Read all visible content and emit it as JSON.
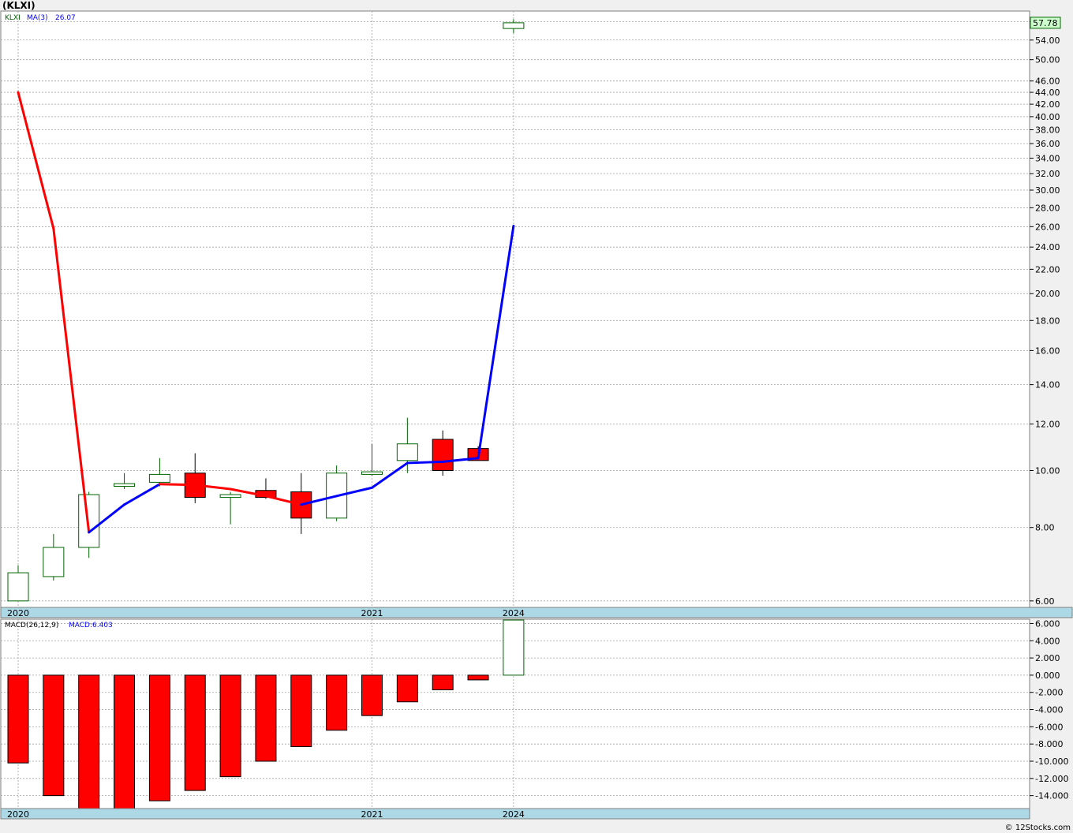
{
  "title": "(KLXI)",
  "legend": {
    "symbol": "KLXI",
    "ma_label": "MA(3)",
    "ma_value": "26.07",
    "macd_label": "MACD(26,12,9)",
    "macd_value_label": "MACD:6.403"
  },
  "last_price_label": "57.78",
  "footer": "© 12Stocks.com",
  "colors": {
    "up": "#006400",
    "down": "#ff0000",
    "ma_up": "#0000ff",
    "ma_down": "#ff0000",
    "date_band": "#add8e6",
    "grid": "#a0a0a0",
    "price_box": "#ccffcc"
  },
  "chart_data": [
    {
      "type": "candlestick",
      "scale": "log",
      "ylim": [
        5.85,
        60.5
      ],
      "y_ticks": [
        6,
        8,
        10,
        12,
        14,
        16,
        18,
        20,
        22,
        24,
        26,
        28,
        30,
        32,
        34,
        36,
        38,
        40,
        42,
        44,
        46,
        50,
        54,
        58
      ],
      "y_tick_labels": [
        "6.00",
        "8.00",
        "10.00",
        "12.00",
        "14.00",
        "16.00",
        "18.00",
        "20.00",
        "22.00",
        "24.00",
        "26.00",
        "28.00",
        "30.00",
        "32.00",
        "34.00",
        "36.00",
        "38.00",
        "40.00",
        "42.00",
        "44.00",
        "46.00",
        "50.00",
        "54.00",
        "58.00"
      ],
      "x_labels": [
        {
          "index": 0,
          "text": "2020"
        },
        {
          "index": 10,
          "text": "2021"
        },
        {
          "index": 14,
          "text": "2024"
        }
      ],
      "candles": [
        {
          "o": 6.0,
          "h": 6.9,
          "l": 6.0,
          "c": 6.7
        },
        {
          "o": 6.6,
          "h": 7.8,
          "l": 6.5,
          "c": 7.4
        },
        {
          "o": 7.4,
          "h": 9.2,
          "l": 7.1,
          "c": 9.1
        },
        {
          "o": 9.4,
          "h": 9.9,
          "l": 9.3,
          "c": 9.5
        },
        {
          "o": 9.55,
          "h": 10.5,
          "l": 9.4,
          "c": 9.85
        },
        {
          "o": 9.9,
          "h": 10.7,
          "l": 8.8,
          "c": 9.0
        },
        {
          "o": 9.0,
          "h": 9.2,
          "l": 8.1,
          "c": 9.1
        },
        {
          "o": 9.25,
          "h": 9.7,
          "l": 8.95,
          "c": 9.0
        },
        {
          "o": 9.2,
          "h": 9.9,
          "l": 7.8,
          "c": 8.3
        },
        {
          "o": 8.3,
          "h": 10.2,
          "l": 8.2,
          "c": 9.9
        },
        {
          "o": 9.85,
          "h": 11.1,
          "l": 9.8,
          "c": 9.95
        },
        {
          "o": 10.4,
          "h": 12.3,
          "l": 9.9,
          "c": 11.1
        },
        {
          "o": 11.3,
          "h": 11.7,
          "l": 9.8,
          "c": 10.0
        },
        {
          "o": 10.9,
          "h": 11.0,
          "l": 10.4,
          "c": 10.4
        },
        {
          "o": 56.5,
          "h": 58.6,
          "l": 55.5,
          "c": 57.78
        }
      ],
      "ma3": [
        44.0,
        25.8,
        7.85,
        8.75,
        9.48,
        9.45,
        9.3,
        9.05,
        8.75,
        9.05,
        9.35,
        10.3,
        10.35,
        10.5,
        26.07
      ]
    },
    {
      "type": "bar",
      "name": "MACD(26,12,9)",
      "ylim": [
        -15.5,
        6.5
      ],
      "y_ticks": [
        6,
        4,
        2,
        0,
        -2,
        -4,
        -6,
        -8,
        -10,
        -12,
        -14
      ],
      "y_tick_labels": [
        "6.000",
        "4.000",
        "2.000",
        "0.000",
        "-2.000",
        "-4.000",
        "-6.000",
        "-8.000",
        "-10.000",
        "-12.000",
        "-14.000"
      ],
      "values": [
        -10.2,
        -14.0,
        -15.5,
        -15.5,
        -14.6,
        -13.4,
        -11.8,
        -10.0,
        -8.3,
        -6.4,
        -4.7,
        -3.1,
        -1.7,
        -0.55,
        6.403
      ]
    }
  ]
}
